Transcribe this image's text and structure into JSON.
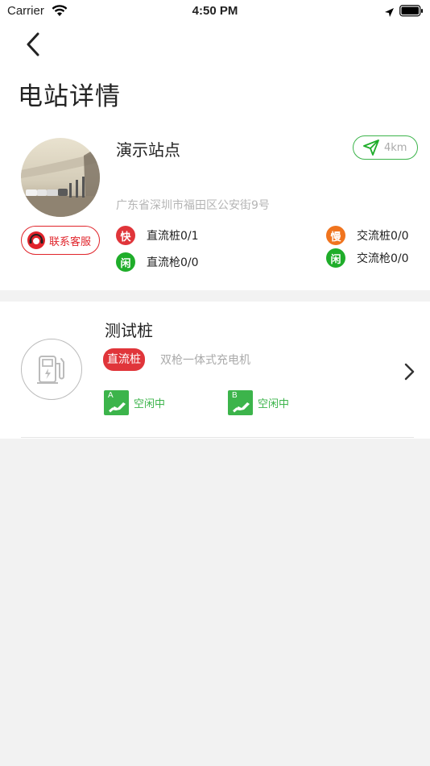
{
  "status_bar": {
    "carrier": "Carrier",
    "time": "4:50 PM"
  },
  "header": {
    "title": "电站详情"
  },
  "station": {
    "name": "演示站点",
    "distance": "4km",
    "address": "广东省深圳市福田区公安街9号",
    "service_label": "联系客服",
    "stats": {
      "fast_badge": "快",
      "dc_pile_label": "直流桩0/1",
      "idle_badge_1": "闲",
      "dc_gun_label": "直流枪0/0",
      "slow_badge": "慢",
      "ac_pile_label": "交流桩0/0",
      "idle_badge_2": "闲",
      "ac_gun_label": "交流枪0/0"
    }
  },
  "pile": {
    "name": "测试桩",
    "type_tag": "直流桩",
    "description": "双枪一体式充电机",
    "guns": [
      {
        "letter": "A",
        "status": "空闲中"
      },
      {
        "letter": "B",
        "status": "空闲中"
      }
    ]
  },
  "colors": {
    "accent_green": "#3cb44b",
    "accent_red": "#e0242b",
    "fast_red": "#e0353a",
    "slow_orange": "#f0741e",
    "idle_green": "#1fad2a"
  }
}
